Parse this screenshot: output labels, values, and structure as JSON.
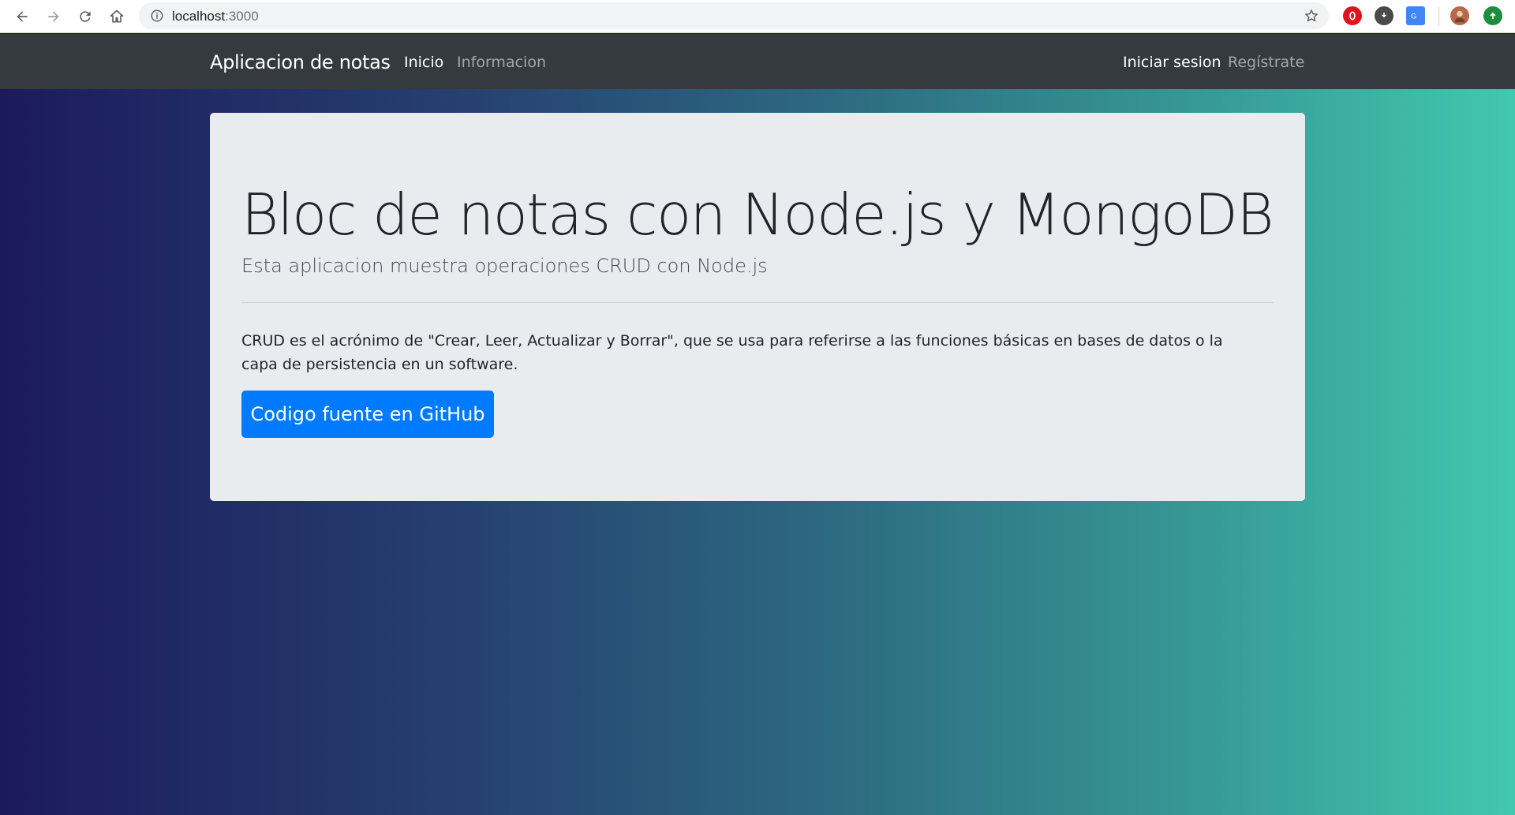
{
  "browser": {
    "url_host": "localhost",
    "url_port": ":3000"
  },
  "navbar": {
    "brand": "Aplicacion de notas",
    "links": [
      {
        "label": "Inicio",
        "active": true
      },
      {
        "label": "Informacion",
        "active": false
      }
    ],
    "auth": [
      {
        "label": "Iniciar sesion",
        "active": true
      },
      {
        "label": "Regístrate",
        "active": false
      }
    ]
  },
  "hero": {
    "title": "Bloc de notas con Node.js y MongoDB",
    "subtitle": "Esta aplicacion muestra operaciones CRUD con Node.js",
    "description": "CRUD es el acrónimo de \"Crear, Leer, Actualizar y Borrar\", que se usa para referirse a las funciones básicas en bases de datos o la capa de persistencia en un software.",
    "button_label": "Codigo fuente en GitHub"
  },
  "colors": {
    "navbar_bg": "#343a40",
    "primary": "#007bff",
    "jumbotron_bg": "#e9ecef",
    "gradient_start": "#1c1a5c",
    "gradient_end": "#42c8b0"
  }
}
